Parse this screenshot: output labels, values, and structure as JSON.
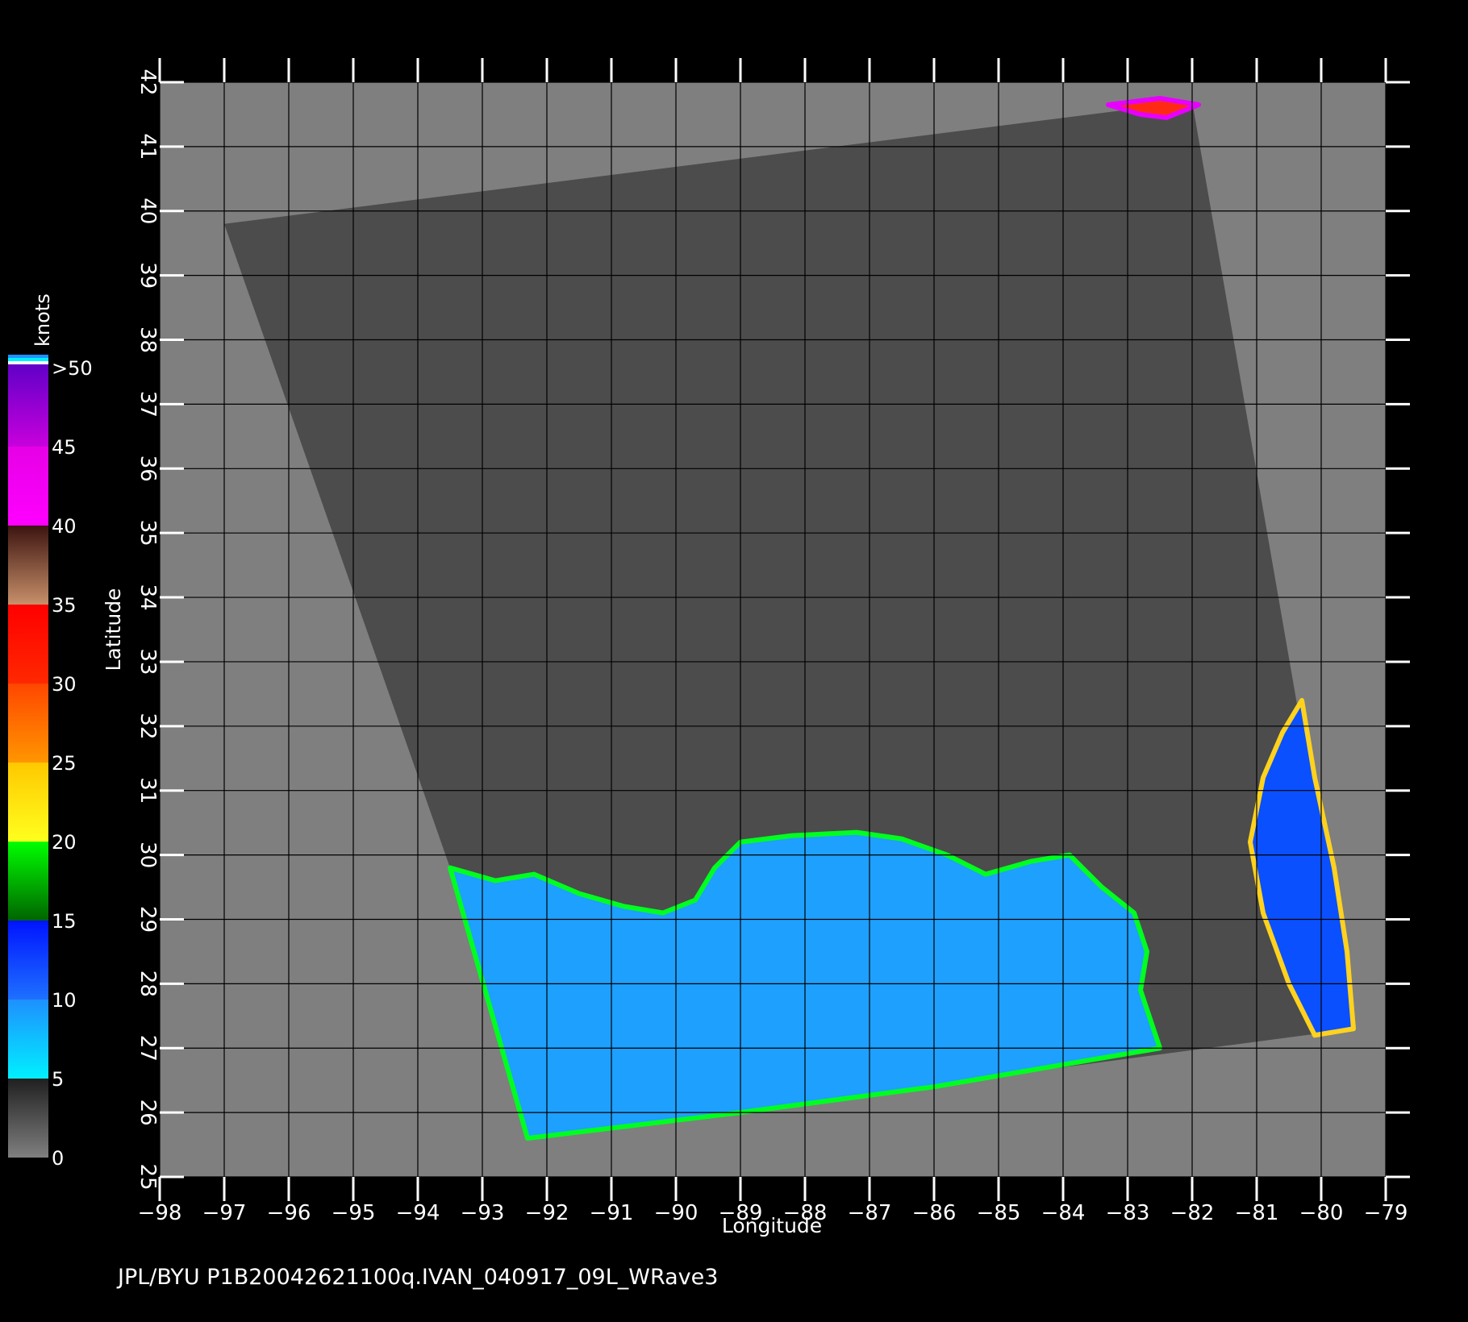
{
  "map": {
    "background_color": "#7f7f7f",
    "swath_color": "#4c4c4c",
    "grid_color": "#000000",
    "x_axis": {
      "title": "Longitude",
      "min": -98,
      "max": -79,
      "ticks": [
        -98,
        -97,
        -96,
        -95,
        -94,
        -93,
        -92,
        -91,
        -90,
        -89,
        -88,
        -87,
        -86,
        -85,
        -84,
        -83,
        -82,
        -81,
        -80,
        -79
      ],
      "tick_labels": [
        "−98",
        "−97",
        "−96",
        "−95",
        "−94",
        "−93",
        "−92",
        "−91",
        "−90",
        "−89",
        "−88",
        "−87",
        "−86",
        "−85",
        "−84",
        "−83",
        "−82",
        "−81",
        "−80",
        "−79"
      ]
    },
    "y_axis": {
      "title": "Latitude",
      "min": 25,
      "max": 42,
      "ticks": [
        25,
        26,
        27,
        28,
        29,
        30,
        31,
        32,
        33,
        34,
        35,
        36,
        37,
        38,
        39,
        40,
        41,
        42
      ],
      "tick_labels": [
        "25",
        "26",
        "27",
        "28",
        "29",
        "30",
        "31",
        "32",
        "33",
        "34",
        "35",
        "36",
        "37",
        "38",
        "39",
        "40",
        "41",
        "42"
      ]
    },
    "swath_corners": [
      {
        "lon": -97.0,
        "lat": 39.8
      },
      {
        "lon": -82.0,
        "lat": 41.7
      },
      {
        "lon": -79.5,
        "lat": 27.3
      },
      {
        "lon": -92.3,
        "lat": 25.6
      },
      {
        "lon": -93.5,
        "lat": 29.8
      }
    ],
    "wind_regions": [
      {
        "name": "gulf-of-mexico",
        "color": "#1ea0ff",
        "edge_color": "#00ff20",
        "polygon": [
          {
            "lon": -93.5,
            "lat": 29.8
          },
          {
            "lon": -92.8,
            "lat": 29.6
          },
          {
            "lon": -92.2,
            "lat": 29.7
          },
          {
            "lon": -91.5,
            "lat": 29.4
          },
          {
            "lon": -90.8,
            "lat": 29.2
          },
          {
            "lon": -90.2,
            "lat": 29.1
          },
          {
            "lon": -89.7,
            "lat": 29.3
          },
          {
            "lon": -89.4,
            "lat": 29.8
          },
          {
            "lon": -89.0,
            "lat": 30.2
          },
          {
            "lon": -88.2,
            "lat": 30.3
          },
          {
            "lon": -87.2,
            "lat": 30.35
          },
          {
            "lon": -86.5,
            "lat": 30.25
          },
          {
            "lon": -85.8,
            "lat": 30.0
          },
          {
            "lon": -85.2,
            "lat": 29.7
          },
          {
            "lon": -84.5,
            "lat": 29.9
          },
          {
            "lon": -83.9,
            "lat": 30.0
          },
          {
            "lon": -83.4,
            "lat": 29.5
          },
          {
            "lon": -82.9,
            "lat": 29.1
          },
          {
            "lon": -82.7,
            "lat": 28.5
          },
          {
            "lon": -82.8,
            "lat": 27.9
          },
          {
            "lon": -82.5,
            "lat": 27.0
          },
          {
            "lon": -86.0,
            "lat": 26.4
          },
          {
            "lon": -89.0,
            "lat": 26.0
          },
          {
            "lon": -92.3,
            "lat": 25.6
          }
        ]
      },
      {
        "name": "atlantic-coast",
        "color": "#0a50ff",
        "edge_color": "#ffd21e",
        "polygon": [
          {
            "lon": -80.3,
            "lat": 32.4
          },
          {
            "lon": -80.1,
            "lat": 31.2
          },
          {
            "lon": -79.8,
            "lat": 29.8
          },
          {
            "lon": -79.6,
            "lat": 28.5
          },
          {
            "lon": -79.5,
            "lat": 27.3
          },
          {
            "lon": -80.1,
            "lat": 27.2
          },
          {
            "lon": -80.5,
            "lat": 28.0
          },
          {
            "lon": -80.9,
            "lat": 29.1
          },
          {
            "lon": -81.1,
            "lat": 30.2
          },
          {
            "lon": -80.9,
            "lat": 31.2
          },
          {
            "lon": -80.6,
            "lat": 31.9
          }
        ]
      },
      {
        "name": "lake-erie",
        "color": "#ff2a14",
        "edge_color": "#e800ff",
        "polygon": [
          {
            "lon": -83.3,
            "lat": 41.65
          },
          {
            "lon": -82.5,
            "lat": 41.75
          },
          {
            "lon": -81.9,
            "lat": 41.65
          },
          {
            "lon": -82.4,
            "lat": 41.45
          },
          {
            "lon": -82.8,
            "lat": 41.5
          }
        ]
      }
    ]
  },
  "colorbar": {
    "unit_label": "knots",
    "segments": [
      {
        "from": 0,
        "to": 5,
        "color_low": "#7f7f7f",
        "color_high": "#202020"
      },
      {
        "from": 5,
        "to": 10,
        "color_low": "#00f0ff",
        "color_high": "#1e90ff"
      },
      {
        "from": 10,
        "to": 15,
        "color_low": "#1e70ff",
        "color_high": "#0014ff"
      },
      {
        "from": 15,
        "to": 20,
        "color_low": "#006400",
        "color_high": "#00ff00"
      },
      {
        "from": 20,
        "to": 25,
        "color_low": "#ffff1e",
        "color_high": "#ffc800"
      },
      {
        "from": 25,
        "to": 30,
        "color_low": "#ff9600",
        "color_high": "#ff4600"
      },
      {
        "from": 30,
        "to": 35,
        "color_low": "#ff2800",
        "color_high": "#ff0000"
      },
      {
        "from": 35,
        "to": 40,
        "color_low": "#c8906a",
        "color_high": "#3c1410"
      },
      {
        "from": 40,
        "to": 45,
        "color_low": "#ff00ff",
        "color_high": "#e600e6"
      },
      {
        "from": 45,
        "to": 50,
        "color_low": "#c800dc",
        "color_high": "#6400c8"
      }
    ],
    "tick_values": [
      0,
      5,
      10,
      15,
      20,
      25,
      30,
      35,
      40,
      45,
      50
    ],
    "tick_labels": [
      "0",
      "5",
      "10",
      "15",
      "20",
      "25",
      "30",
      "35",
      "40",
      "45",
      ">50"
    ],
    "top_stripes": [
      "#1e90ff",
      "#00f0ff",
      "#ffffff",
      "#6400c8"
    ]
  },
  "caption": "JPL/BYU  P1B20042621100q.IVAN_040917_09L_WRave3"
}
